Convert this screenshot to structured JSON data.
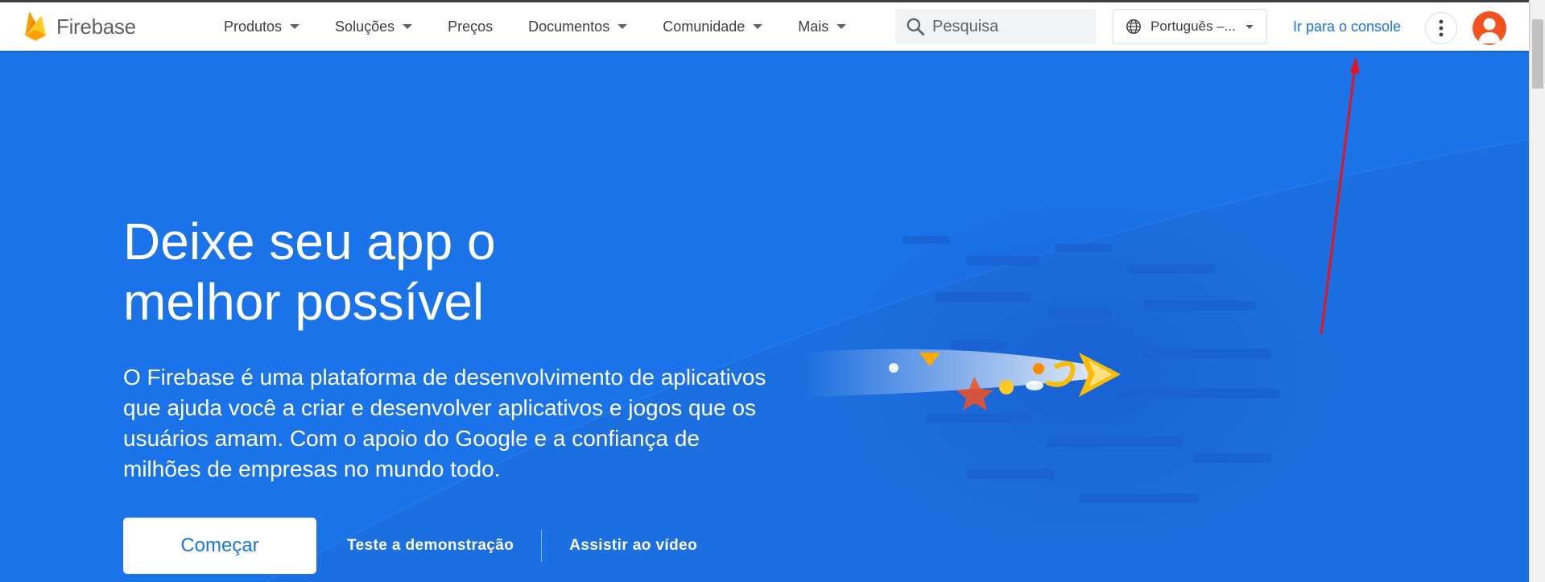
{
  "brand": {
    "name": "Firebase",
    "logo_icon": "firebase-flame-icon"
  },
  "nav": {
    "items": [
      {
        "label": "Produtos",
        "has_menu": true
      },
      {
        "label": "Soluções",
        "has_menu": true
      },
      {
        "label": "Preços",
        "has_menu": false
      },
      {
        "label": "Documentos",
        "has_menu": true
      },
      {
        "label": "Comunidade",
        "has_menu": true
      },
      {
        "label": "Mais",
        "has_menu": true
      }
    ]
  },
  "search": {
    "placeholder": "Pesquisa",
    "icon": "search-icon"
  },
  "language": {
    "label": "Português –...",
    "icon": "globe-icon"
  },
  "header_actions": {
    "console_link": "Ir para o console",
    "more_icon": "more-vert-icon",
    "avatar_icon": "user-avatar-icon"
  },
  "hero": {
    "title": "Deixe seu app o\nmelhor possível",
    "description": "O Firebase é uma plataforma de desenvolvimento de aplicativos que ajuda você a criar e desenvolver aplicativos e jogos que os usuários amam. Com o apoio do Google e a confiança de milhões de empresas no mundo todo.",
    "primary_cta": "Começar",
    "secondary_cta": "Teste a demonstração",
    "tertiary_cta": "Assistir ao vídeo"
  },
  "colors": {
    "hero_background": "#1a73e8",
    "link": "#1a73e8",
    "annotation_arrow": "#e8131b"
  }
}
